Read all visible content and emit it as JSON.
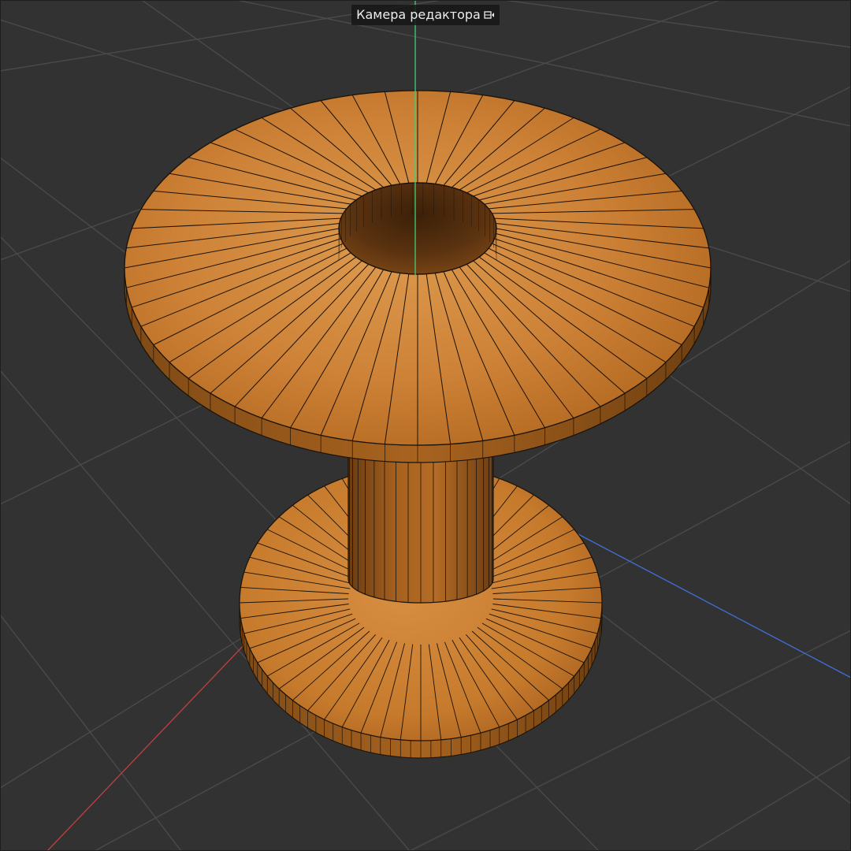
{
  "viewport": {
    "camera_label": "Камера редактора",
    "camera_icon": "camera-icon",
    "background_color": "#323232",
    "grid_color": "#4a4a4a",
    "axis_colors": {
      "x": "#c04040",
      "y": "#3fd07a",
      "z": "#3f6fd8"
    },
    "object_color": "#c6782a",
    "wire_color": "#1a1208"
  }
}
